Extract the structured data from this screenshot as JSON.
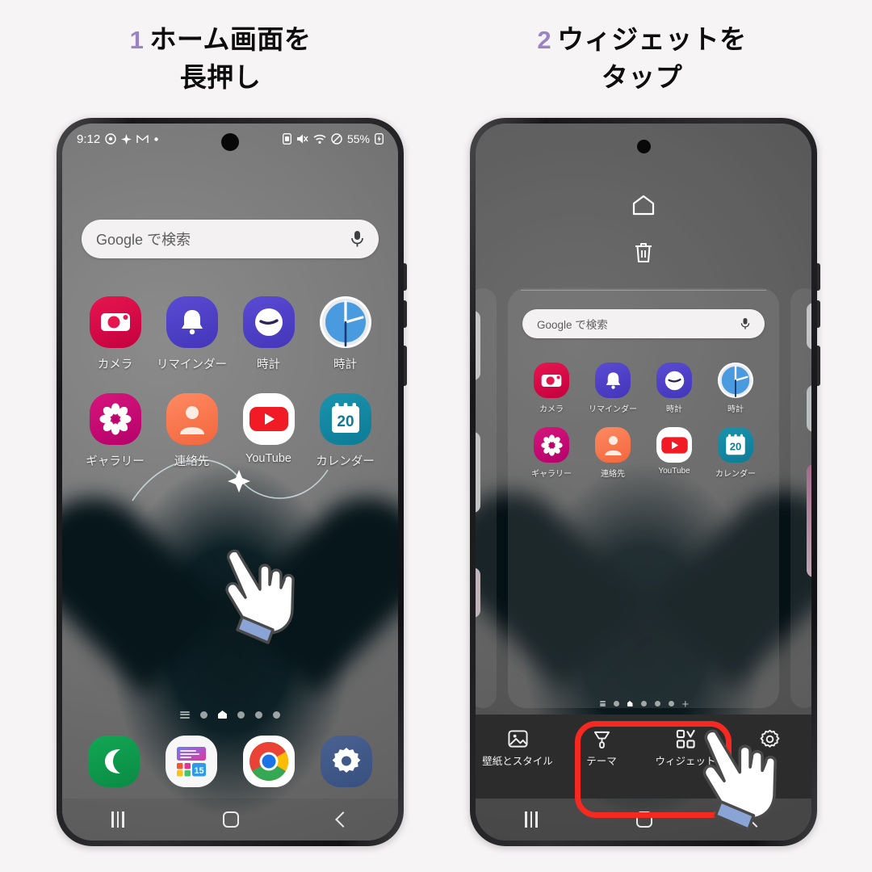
{
  "steps": [
    {
      "number": "1",
      "text_line1": "ホーム画面を",
      "text_line2": "長押し"
    },
    {
      "number": "2",
      "text_line1": "ウィジェットを",
      "text_line2": "タップ"
    }
  ],
  "accent_color": "#9b84c4",
  "highlight_color": "#f5291f",
  "phone1": {
    "status_bar": {
      "time": "9:12",
      "battery_percent": "55%",
      "left_icons": [
        "target-icon",
        "sparkle-icon",
        "gmail-icon",
        "dot-icon"
      ],
      "right_icons": [
        "sim-icon",
        "mute-icon",
        "wifi-icon",
        "dnd-icon",
        "battery-icon"
      ]
    },
    "search": {
      "placeholder": "Google で検索",
      "mic_icon": "microphone-icon"
    },
    "apps_row1": [
      {
        "label": "カメラ",
        "icon": "camera-icon"
      },
      {
        "label": "リマインダー",
        "icon": "bell-icon"
      },
      {
        "label": "時計",
        "icon": "clock-samsung-icon"
      },
      {
        "label": "時計",
        "icon": "clock-google-icon"
      }
    ],
    "apps_row2": [
      {
        "label": "ギャラリー",
        "icon": "flower-icon"
      },
      {
        "label": "連絡先",
        "icon": "person-icon"
      },
      {
        "label": "YouTube",
        "icon": "youtube-icon"
      },
      {
        "label": "カレンダー",
        "icon": "calendar-icon",
        "day": "20"
      }
    ],
    "dock": [
      {
        "label": "",
        "icon": "phone-icon"
      },
      {
        "label": "",
        "icon": "app-grid-icon",
        "day": "15"
      },
      {
        "label": "",
        "icon": "chrome-icon"
      },
      {
        "label": "",
        "icon": "settings-gear-icon"
      }
    ],
    "page_dots": [
      "lines",
      "dot",
      "home",
      "dot",
      "dot",
      "dot"
    ],
    "nav": [
      "recents-button",
      "home-button",
      "back-button"
    ]
  },
  "phone2": {
    "edit_mode": {
      "home_icon": "home-outline-icon",
      "trash_icon": "trash-icon"
    },
    "search": {
      "placeholder": "Google で検索",
      "mic_icon": "microphone-icon"
    },
    "apps_row1": [
      {
        "label": "カメラ",
        "icon": "camera-icon"
      },
      {
        "label": "リマインダー",
        "icon": "bell-icon"
      },
      {
        "label": "時計",
        "icon": "clock-samsung-icon"
      },
      {
        "label": "時計",
        "icon": "clock-google-icon"
      }
    ],
    "apps_row2": [
      {
        "label": "ギャラリー",
        "icon": "flower-icon"
      },
      {
        "label": "連絡先",
        "icon": "person-icon"
      },
      {
        "label": "YouTube",
        "icon": "youtube-icon"
      },
      {
        "label": "カレンダー",
        "icon": "calendar-icon",
        "day": "20"
      }
    ],
    "page_dots": [
      "lines",
      "dot",
      "home",
      "dot",
      "dot",
      "dot",
      "plus"
    ],
    "toolbar": [
      {
        "label": "壁紙とスタイル",
        "icon": "wallpaper-image-icon",
        "highlighted": false
      },
      {
        "label": "テーマ",
        "icon": "theme-brush-icon",
        "highlighted": false
      },
      {
        "label": "ウィジェット",
        "icon": "widgets-grid-icon",
        "highlighted": true
      },
      {
        "label": "",
        "icon": "settings-gear-icon",
        "highlighted": false
      }
    ],
    "nav": [
      "recents-button",
      "home-button",
      "back-button"
    ]
  },
  "cursors": [
    {
      "name": "pointing-hand-phone1"
    },
    {
      "name": "pointing-hand-phone2"
    }
  ]
}
